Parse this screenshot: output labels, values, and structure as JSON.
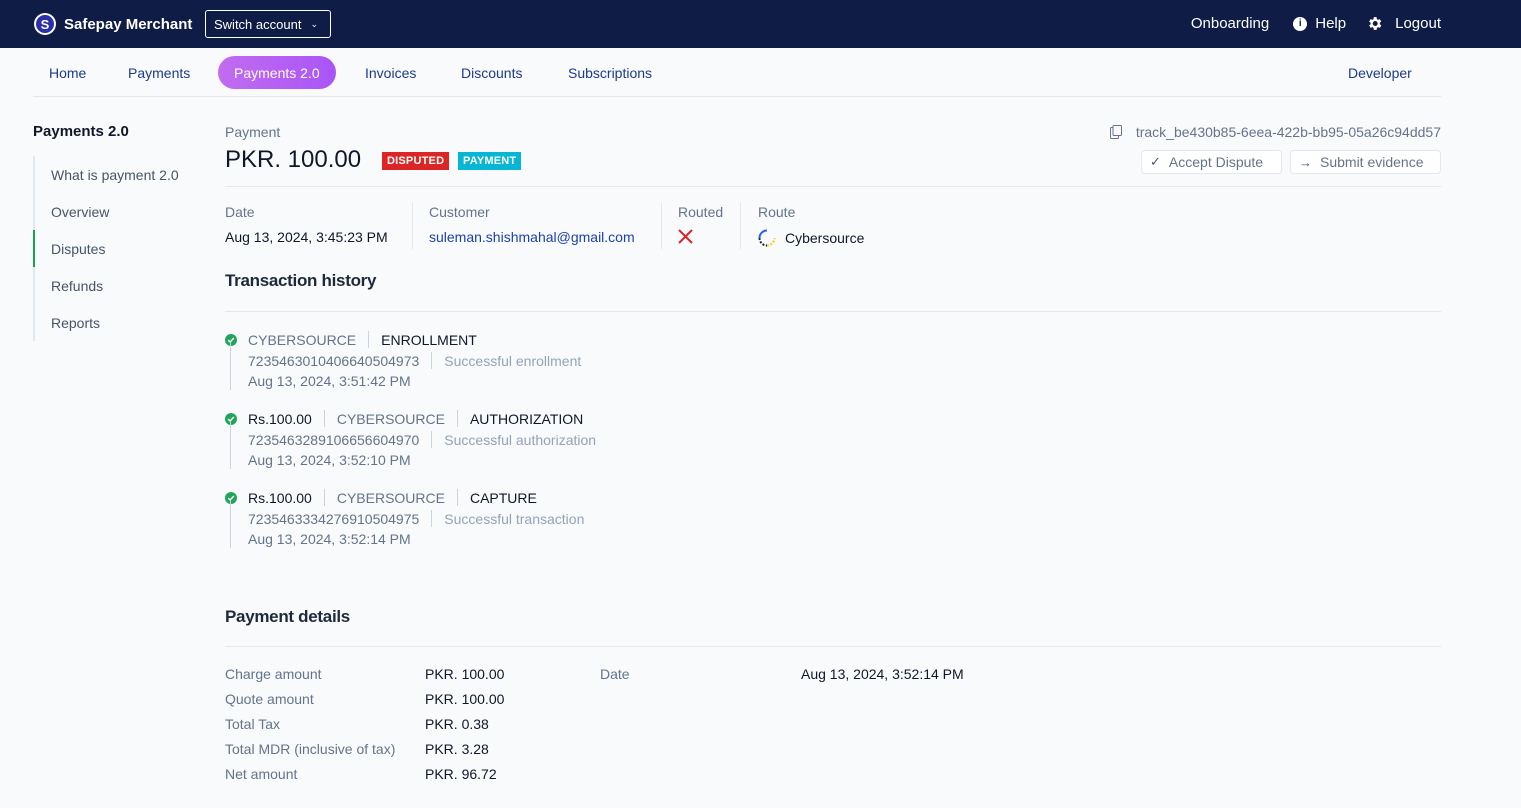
{
  "topbar": {
    "brand_logo_letter": "S",
    "brand_name": "Safepay Merchant",
    "switch_account": "Switch account",
    "onboarding": "Onboarding",
    "help": "Help",
    "logout": "Logout"
  },
  "nav": {
    "items": [
      "Home",
      "Payments",
      "Payments 2.0",
      "Invoices",
      "Discounts",
      "Subscriptions"
    ],
    "active": "Payments 2.0",
    "developer": "Developer"
  },
  "sidebar": {
    "title": "Payments 2.0",
    "items": [
      "What is payment 2.0",
      "Overview",
      "Disputes",
      "Refunds",
      "Reports"
    ],
    "active": "Disputes"
  },
  "payment": {
    "label": "Payment",
    "amount": "PKR. 100.00",
    "badges": [
      "DISPUTED",
      "PAYMENT"
    ],
    "tracker": "track_be430b85-6eea-422b-bb95-05a26c94dd57",
    "accept_dispute": "Accept Dispute",
    "submit_evidence": "Submit evidence"
  },
  "meta": {
    "date_label": "Date",
    "date_value": "Aug 13, 2024, 3:45:23 PM",
    "customer_label": "Customer",
    "customer_value": "suleman.shishmahal@gmail.com",
    "routed_label": "Routed",
    "route_label": "Route",
    "route_value": "Cybersource"
  },
  "history": {
    "title": "Transaction history",
    "entries": [
      {
        "amount": "",
        "provider": "CYBERSOURCE",
        "type": "ENROLLMENT",
        "ref": "7235463010406640504973",
        "message": "Successful enrollment",
        "time": "Aug 13, 2024, 3:51:42 PM"
      },
      {
        "amount": "Rs.100.00",
        "provider": "CYBERSOURCE",
        "type": "AUTHORIZATION",
        "ref": "7235463289106656604970",
        "message": "Successful authorization",
        "time": "Aug 13, 2024, 3:52:10 PM"
      },
      {
        "amount": "Rs.100.00",
        "provider": "CYBERSOURCE",
        "type": "CAPTURE",
        "ref": "7235463334276910504975",
        "message": "Successful transaction",
        "time": "Aug 13, 2024, 3:52:14 PM"
      }
    ]
  },
  "details": {
    "title": "Payment details",
    "rows": [
      {
        "label": "Charge amount",
        "value": "PKR. 100.00"
      },
      {
        "label": "Quote amount",
        "value": "PKR. 100.00"
      },
      {
        "label": "Total Tax",
        "value": "PKR. 0.38"
      },
      {
        "label": "Total MDR (inclusive of tax)",
        "value": "PKR. 3.28"
      },
      {
        "label": "Net amount",
        "value": "PKR. 96.72"
      }
    ],
    "date_label": "Date",
    "date_value": "Aug 13, 2024, 3:52:14 PM"
  },
  "colors": {
    "topbar": "#0f1d46",
    "active_tab": "#a855f7",
    "disputed": "#dc2626",
    "payment": "#06b6d4",
    "success": "#22a55a"
  }
}
